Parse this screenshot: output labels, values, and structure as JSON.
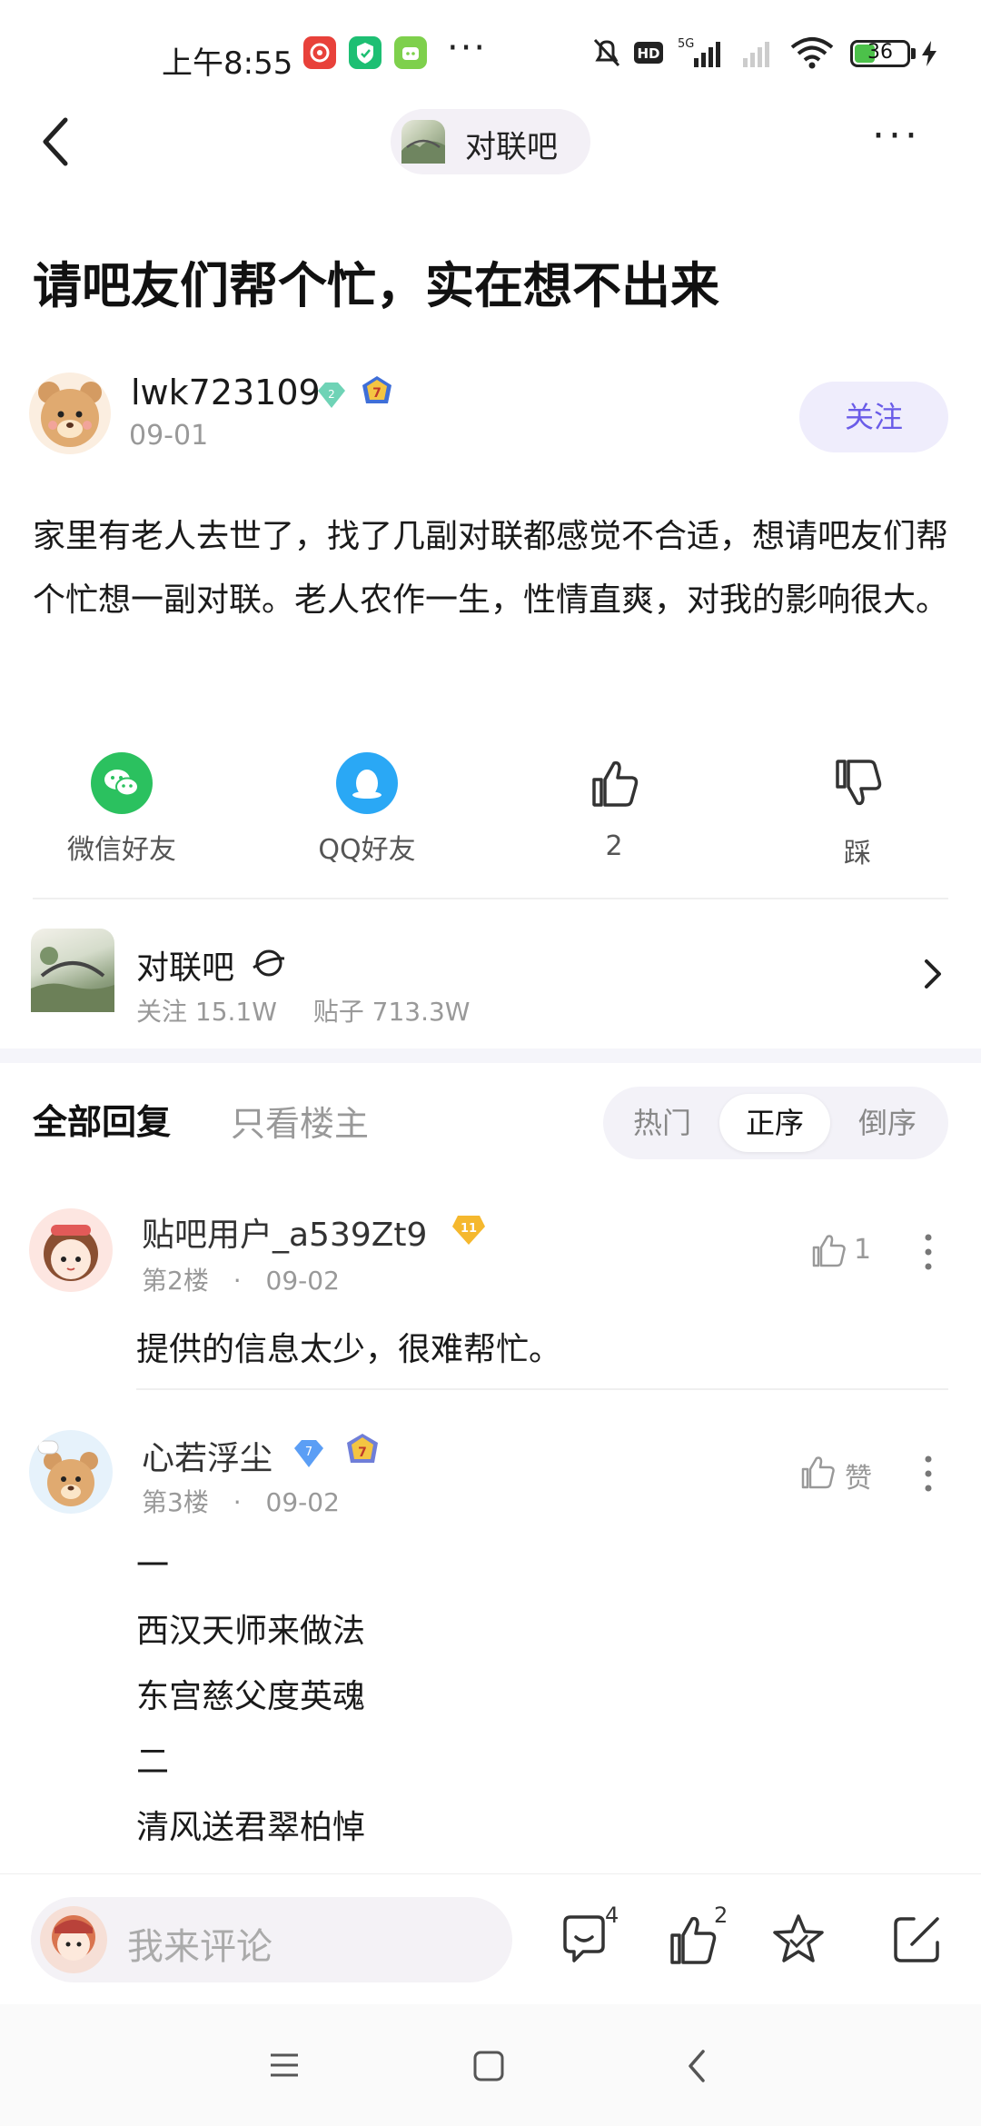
{
  "status_bar": {
    "time": "上午8:55",
    "network": "5G",
    "battery": "36",
    "battery_level": 0.36
  },
  "nav": {
    "forum_name": "对联吧"
  },
  "post": {
    "title": "请吧友们帮个忙，实在想不出来",
    "author": "lwk723109",
    "author_badge_level": "2",
    "author_member_level": "7",
    "date": "09-01",
    "follow_label": "关注",
    "body": "家里有老人去世了，找了几副对联都感觉不合适，想请吧友们帮个忙想一副对联。老人农作一生，性情直爽，对我的影响很大。"
  },
  "share": {
    "wechat_label": "微信好友",
    "qq_label": "QQ好友",
    "like_count": "2",
    "dislike_label": "踩"
  },
  "forum_card": {
    "name": "对联吧",
    "follow_stat": "关注 15.1W",
    "post_stat": "贴子 713.3W"
  },
  "replies": {
    "tab_all": "全部回复",
    "tab_op": "只看楼主",
    "sort": [
      "热门",
      "正序",
      "倒序"
    ],
    "items": [
      {
        "user": "贴吧用户_a539Zt9",
        "badge_level": "11",
        "floor": "第2楼",
        "date": "09-02",
        "like": "1",
        "text": "提供的信息太少，很难帮忙。"
      },
      {
        "user": "心若浮尘",
        "badge_level": "7",
        "member_level": "7",
        "floor": "第3楼",
        "date": "09-02",
        "like": "赞",
        "lines": [
          "一",
          "西汉天师来做法",
          "东宫慈父度英魂",
          "二",
          "清风送君翠柏悼"
        ]
      }
    ]
  },
  "bottom_bar": {
    "comment_placeholder": "我来评论",
    "comment_count": "4",
    "like_count": "2"
  },
  "colors": {
    "accent": "#6a5ce8",
    "wechat": "#2bc15f",
    "qq": "#2aa8f5",
    "battery": "#4cc14a"
  }
}
